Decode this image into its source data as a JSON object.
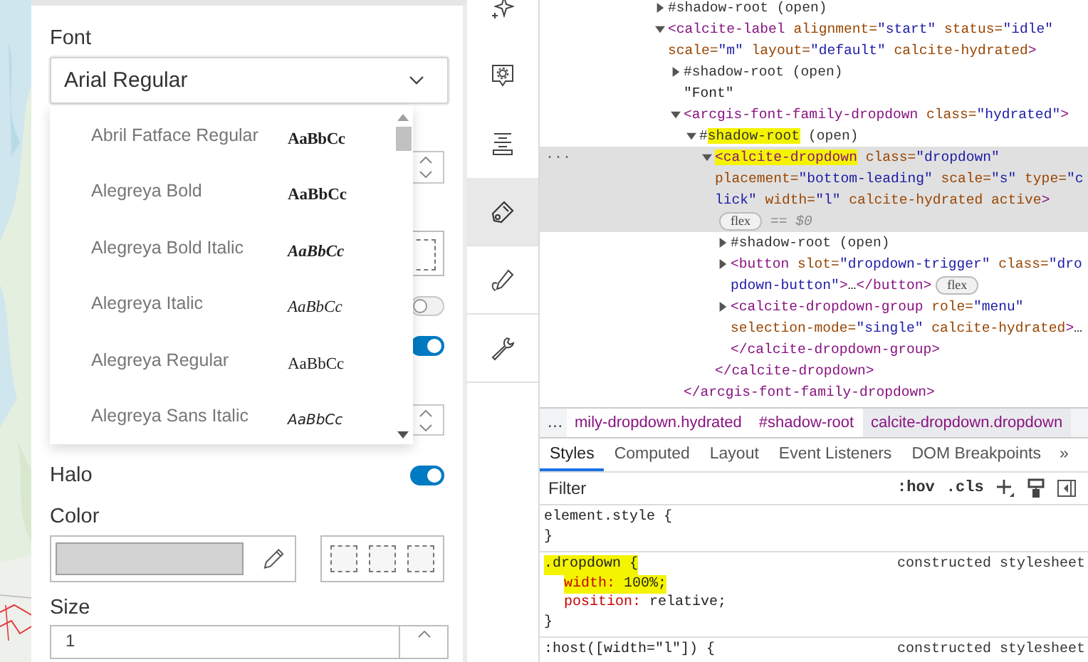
{
  "panel": {
    "font_label": "Font",
    "font_dropdown": {
      "value": "Arial Regular",
      "expanded": true
    },
    "font_options": [
      {
        "name": "Abril Fatface Regular",
        "sample": "AaBbCc"
      },
      {
        "name": "Alegreya Bold",
        "sample": "AaBbCc"
      },
      {
        "name": "Alegreya Bold Italic",
        "sample": "AaBbCc"
      },
      {
        "name": "Alegreya Italic",
        "sample": "AaBbCc"
      },
      {
        "name": "Alegreya Regular",
        "sample": "AaBbCc"
      },
      {
        "name": "Alegreya Sans Italic",
        "sample": "AaBbCc"
      }
    ],
    "covered_controls": [
      {
        "kind": "spinner"
      },
      {
        "kind": "swatch"
      },
      {
        "kind": "toggle",
        "on": false
      },
      {
        "kind": "toggle",
        "on": true
      },
      {
        "kind": "spinner"
      }
    ],
    "halo": {
      "label": "Halo",
      "on": true
    },
    "color": {
      "label": "Color"
    },
    "size": {
      "label": "Size",
      "value": "1"
    }
  },
  "toolbar": {
    "items": [
      {
        "selected": false
      },
      {
        "selected": false
      },
      {
        "selected": false
      },
      {
        "selected": true
      },
      {
        "selected": false
      },
      {
        "selected": false
      }
    ]
  },
  "devtools": {
    "elements": {
      "gutter_mark": "···",
      "tree": [
        {
          "kind": "element",
          "expanded": false,
          "selected": false,
          "lines": [
            [
              {
                "kind": "pseudo",
                "text": "#shadow-root (open)",
                "highlight": false
              }
            ]
          ]
        },
        {
          "kind": "element",
          "expanded": true,
          "selected": false,
          "lines": [
            [
              {
                "kind": "tag",
                "text": "<calcite-label",
                "highlight": false
              },
              {
                "kind": "attr",
                "text": " alignment=",
                "highlight": false
              },
              {
                "kind": "val",
                "text": "\"start\"",
                "highlight": false
              },
              {
                "kind": "attr",
                "text": " status=",
                "highlight": false
              },
              {
                "kind": "val",
                "text": "\"idle\"",
                "highlight": false
              }
            ],
            [
              {
                "kind": "attr",
                "text": "scale=",
                "highlight": false
              },
              {
                "kind": "val",
                "text": "\"m\"",
                "highlight": false
              },
              {
                "kind": "attr",
                "text": " layout=",
                "highlight": false
              },
              {
                "kind": "val",
                "text": "\"default\"",
                "highlight": false
              },
              {
                "kind": "attr",
                "text": " calcite-hydrated",
                "highlight": false
              },
              {
                "kind": "tag",
                "text": ">",
                "highlight": false
              }
            ]
          ],
          "children": [
            {
              "kind": "element",
              "expanded": false,
              "selected": false,
              "lines": [
                [
                  {
                    "kind": "pseudo",
                    "text": "#shadow-root (open)",
                    "highlight": false
                  }
                ]
              ]
            },
            {
              "kind": "text",
              "selected": false,
              "lines": [
                [
                  {
                    "kind": "text",
                    "text": "\"Font\"",
                    "highlight": false
                  }
                ]
              ]
            },
            {
              "kind": "element",
              "expanded": true,
              "selected": false,
              "lines": [
                [
                  {
                    "kind": "tag",
                    "text": "<arcgis-font-family-dropdown",
                    "highlight": false
                  },
                  {
                    "kind": "attr",
                    "text": " class=",
                    "highlight": false
                  },
                  {
                    "kind": "val",
                    "text": "\"hydrated\"",
                    "highlight": false
                  },
                  {
                    "kind": "tag",
                    "text": ">",
                    "highlight": false
                  }
                ]
              ],
              "closing": [
                {
                  "kind": "tag",
                  "text": "</arcgis-font-family-dropdown>",
                  "highlight": false
                }
              ],
              "children": [
                {
                  "kind": "element",
                  "expanded": true,
                  "selected": false,
                  "lines": [
                    [
                      {
                        "kind": "pseudo",
                        "text": "#",
                        "highlight": false
                      },
                      {
                        "kind": "pseudo",
                        "text": "shadow-root",
                        "highlight": true
                      },
                      {
                        "kind": "pseudo",
                        "text": " (open)",
                        "highlight": false
                      }
                    ]
                  ],
                  "children": [
                    {
                      "kind": "element",
                      "expanded": true,
                      "selected": true,
                      "lines": [
                        [
                          {
                            "kind": "tag",
                            "text": "<calcite-dropdown",
                            "highlight": true
                          },
                          {
                            "kind": "attr",
                            "text": " class=",
                            "highlight": false
                          },
                          {
                            "kind": "val",
                            "text": "\"dropdown\"",
                            "highlight": false
                          }
                        ],
                        [
                          {
                            "kind": "attr",
                            "text": "placement=",
                            "highlight": false
                          },
                          {
                            "kind": "val",
                            "text": "\"bottom-leading\"",
                            "highlight": false
                          },
                          {
                            "kind": "attr",
                            "text": " scale=",
                            "highlight": false
                          },
                          {
                            "kind": "val",
                            "text": "\"s\"",
                            "highlight": false
                          },
                          {
                            "kind": "attr",
                            "text": " type=",
                            "highlight": false
                          },
                          {
                            "kind": "val",
                            "text": "\"c",
                            "highlight": false
                          }
                        ],
                        [
                          {
                            "kind": "val",
                            "text": "lick\"",
                            "highlight": false
                          },
                          {
                            "kind": "attr",
                            "text": " width=",
                            "highlight": false
                          },
                          {
                            "kind": "val",
                            "text": "\"l\"",
                            "highlight": false
                          },
                          {
                            "kind": "attr",
                            "text": " calcite-hydrated active",
                            "highlight": false
                          },
                          {
                            "kind": "tag",
                            "text": ">",
                            "highlight": false
                          }
                        ],
                        [
                          {
                            "kind": "badge",
                            "text": "flex",
                            "highlight": false
                          },
                          {
                            "kind": "ref",
                            "text": "== $0",
                            "highlight": false
                          }
                        ]
                      ],
                      "closing": [
                        {
                          "kind": "tag",
                          "text": "</calcite-dropdown>",
                          "highlight": false
                        }
                      ],
                      "children": [
                        {
                          "kind": "element",
                          "expanded": false,
                          "selected": false,
                          "lines": [
                            [
                              {
                                "kind": "pseudo",
                                "text": "#shadow-root (open)",
                                "highlight": false
                              }
                            ]
                          ]
                        },
                        {
                          "kind": "element",
                          "expanded": false,
                          "selected": false,
                          "lines": [
                            [
                              {
                                "kind": "tag",
                                "text": "<button",
                                "highlight": false
                              },
                              {
                                "kind": "attr",
                                "text": " slot=",
                                "highlight": false
                              },
                              {
                                "kind": "val",
                                "text": "\"dropdown-trigger\"",
                                "highlight": false
                              },
                              {
                                "kind": "attr",
                                "text": " class=",
                                "highlight": false
                              },
                              {
                                "kind": "val",
                                "text": "\"dro",
                                "highlight": false
                              }
                            ],
                            [
                              {
                                "kind": "val",
                                "text": "pdown-button\"",
                                "highlight": false
                              },
                              {
                                "kind": "tag",
                                "text": ">",
                                "highlight": false
                              },
                              {
                                "kind": "text",
                                "text": "…",
                                "highlight": false
                              },
                              {
                                "kind": "tag",
                                "text": "</button>",
                                "highlight": false
                              },
                              {
                                "kind": "badge",
                                "text": "flex",
                                "highlight": false
                              }
                            ]
                          ]
                        },
                        {
                          "kind": "element",
                          "expanded": false,
                          "selected": false,
                          "lines": [
                            [
                              {
                                "kind": "tag",
                                "text": "<calcite-dropdown-group",
                                "highlight": false
                              },
                              {
                                "kind": "attr",
                                "text": " role=",
                                "highlight": false
                              },
                              {
                                "kind": "val",
                                "text": "\"menu\"",
                                "highlight": false
                              }
                            ],
                            [
                              {
                                "kind": "attr",
                                "text": "selection-mode=",
                                "highlight": false
                              },
                              {
                                "kind": "val",
                                "text": "\"single\"",
                                "highlight": false
                              },
                              {
                                "kind": "attr",
                                "text": " calcite-hydrated",
                                "highlight": false
                              },
                              {
                                "kind": "tag",
                                "text": ">",
                                "highlight": false
                              },
                              {
                                "kind": "text",
                                "text": "…",
                                "highlight": false
                              }
                            ],
                            [
                              {
                                "kind": "tag",
                                "text": "</calcite-dropdown-group>",
                                "highlight": false
                              }
                            ]
                          ]
                        }
                      ]
                    }
                  ]
                }
              ]
            }
          ]
        }
      ]
    },
    "breadcrumbs": {
      "lead": "…",
      "items": [
        {
          "text": "mily-dropdown.hydrated",
          "selected": false
        },
        {
          "text": "#shadow-root",
          "selected": false
        },
        {
          "text": "calcite-dropdown.dropdown",
          "selected": true
        }
      ]
    },
    "tabs": [
      {
        "label": "Styles",
        "selected": true
      },
      {
        "label": "Computed",
        "selected": false
      },
      {
        "label": "Layout",
        "selected": false
      },
      {
        "label": "Event Listeners",
        "selected": false
      },
      {
        "label": "DOM Breakpoints",
        "selected": false
      }
    ],
    "more_tabs": "»",
    "filter": {
      "placeholder": "Filter",
      "tools": [
        ":hov",
        ".cls"
      ]
    },
    "rules": [
      {
        "selector": "element.style {",
        "close": "}",
        "highlight": false
      },
      {
        "selector": ".dropdown {",
        "source": "constructed stylesheet",
        "close": "}",
        "highlight": true,
        "declarations": [
          {
            "property": "width:",
            "value": "100%;",
            "highlight": true
          },
          {
            "property": "position:",
            "value": "relative;",
            "highlight": false
          }
        ]
      },
      {
        "selector": ":host([width=\"l\"]) {",
        "source": "constructed stylesheet",
        "highlight": false
      }
    ]
  }
}
